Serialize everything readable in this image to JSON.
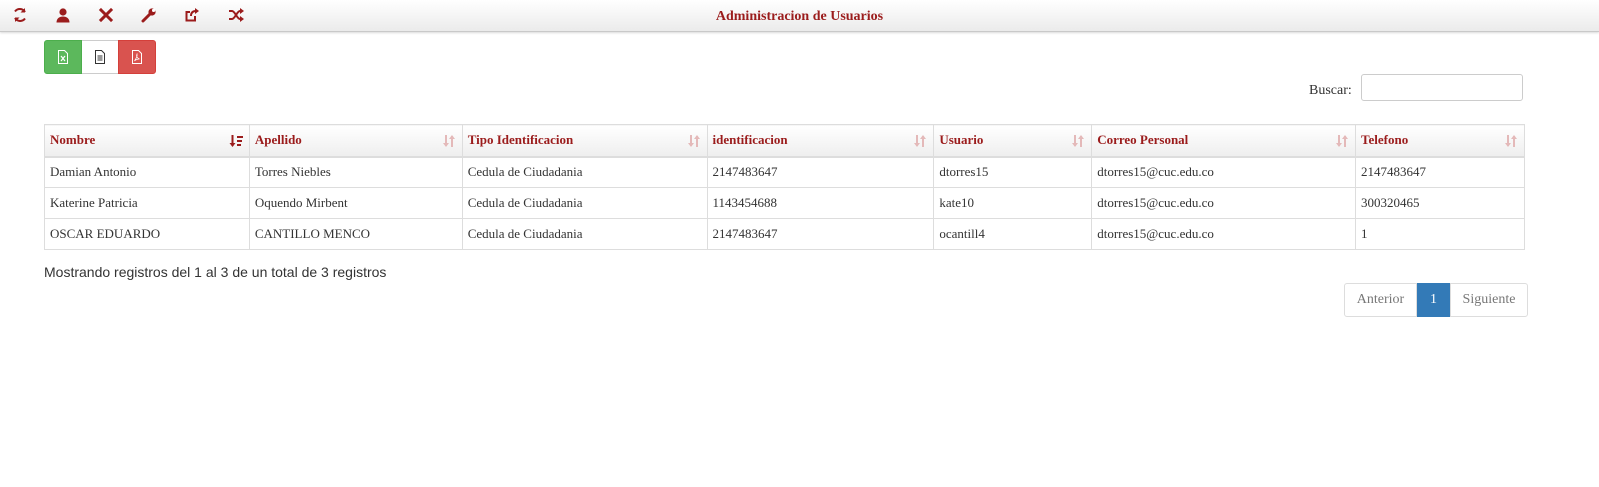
{
  "toolbar": {
    "title": "Administracion de Usuarios",
    "icons": [
      "refresh-icon",
      "user-icon",
      "close-icon",
      "wrench-icon",
      "share-icon",
      "shuffle-icon"
    ],
    "icon_color": "#9b1c1c"
  },
  "export": {
    "buttons": [
      "excel-icon",
      "csv-icon",
      "pdf-icon"
    ],
    "colors": {
      "excel": "#5cb85c",
      "pdf": "#d9534f"
    }
  },
  "search": {
    "label": "Buscar:",
    "value": "",
    "placeholder": ""
  },
  "table": {
    "columns": [
      "Nombre",
      "Apellido",
      "Tipo Identificacion",
      "identificacion",
      "Usuario",
      "Correo Personal",
      "Telefono"
    ],
    "sorted_column": "Nombre",
    "rows": [
      [
        "Damian Antonio",
        "Torres Niebles",
        "Cedula de Ciudadania",
        "2147483647",
        "dtorres15",
        "dtorres15@cuc.edu.co",
        "2147483647"
      ],
      [
        "Katerine Patricia",
        "Oquendo Mirbent",
        "Cedula de Ciudadania",
        "1143454688",
        "kate10",
        "dtorres15@cuc.edu.co",
        "300320465"
      ],
      [
        "OSCAR EDUARDO",
        "CANTILLO MENCO",
        "Cedula de Ciudadania",
        "2147483647",
        "ocantill4",
        "dtorres15@cuc.edu.co",
        "1"
      ]
    ]
  },
  "info": "Mostrando registros del 1 al 3 de un total de 3 registros",
  "pagination": {
    "prev": "Anterior",
    "current": "1",
    "next": "Siguiente",
    "accent": "#337ab7"
  }
}
